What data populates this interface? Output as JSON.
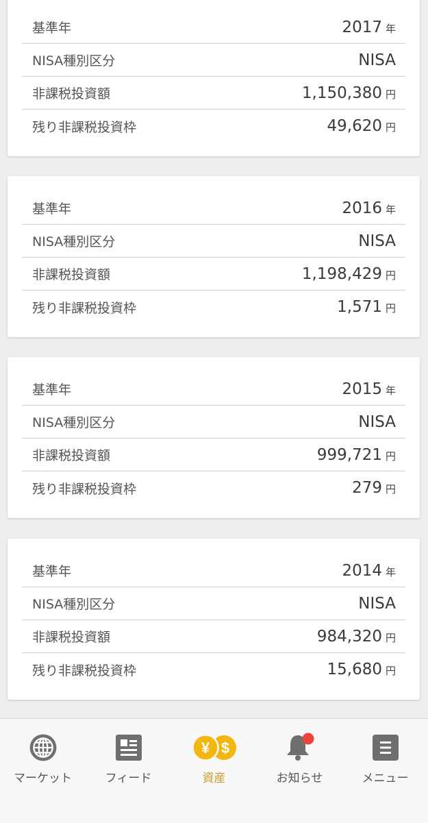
{
  "colors": {
    "accent": "#c99a2e",
    "coin_gold": "#f2b70f",
    "badge_red": "#e8453c",
    "icon_gray": "#6f6f6f"
  },
  "cards": [
    {
      "rows": [
        {
          "label": "基準年",
          "value": "2017",
          "unit": "年"
        },
        {
          "label": "NISA種別区分",
          "value": "NISA",
          "unit": ""
        },
        {
          "label": "非課税投資額",
          "value": "1,150,380",
          "unit": "円"
        },
        {
          "label": "残り非課税投資枠",
          "value": "49,620",
          "unit": "円"
        }
      ]
    },
    {
      "rows": [
        {
          "label": "基準年",
          "value": "2016",
          "unit": "年"
        },
        {
          "label": "NISA種別区分",
          "value": "NISA",
          "unit": ""
        },
        {
          "label": "非課税投資額",
          "value": "1,198,429",
          "unit": "円"
        },
        {
          "label": "残り非課税投資枠",
          "value": "1,571",
          "unit": "円"
        }
      ]
    },
    {
      "rows": [
        {
          "label": "基準年",
          "value": "2015",
          "unit": "年"
        },
        {
          "label": "NISA種別区分",
          "value": "NISA",
          "unit": ""
        },
        {
          "label": "非課税投資額",
          "value": "999,721",
          "unit": "円"
        },
        {
          "label": "残り非課税投資枠",
          "value": "279",
          "unit": "円"
        }
      ]
    },
    {
      "rows": [
        {
          "label": "基準年",
          "value": "2014",
          "unit": "年"
        },
        {
          "label": "NISA種別区分",
          "value": "NISA",
          "unit": ""
        },
        {
          "label": "非課税投資額",
          "value": "984,320",
          "unit": "円"
        },
        {
          "label": "残り非課税投資枠",
          "value": "15,680",
          "unit": "円"
        }
      ]
    }
  ],
  "nav": {
    "items": [
      {
        "label": "マーケット",
        "icon": "globe-icon"
      },
      {
        "label": "フィード",
        "icon": "news-icon"
      },
      {
        "label": "資産",
        "icon": "yen-dollar-coins-icon",
        "active": true
      },
      {
        "label": "お知らせ",
        "icon": "bell-icon",
        "badge": true
      },
      {
        "label": "メニュー",
        "icon": "menu-icon"
      }
    ]
  }
}
